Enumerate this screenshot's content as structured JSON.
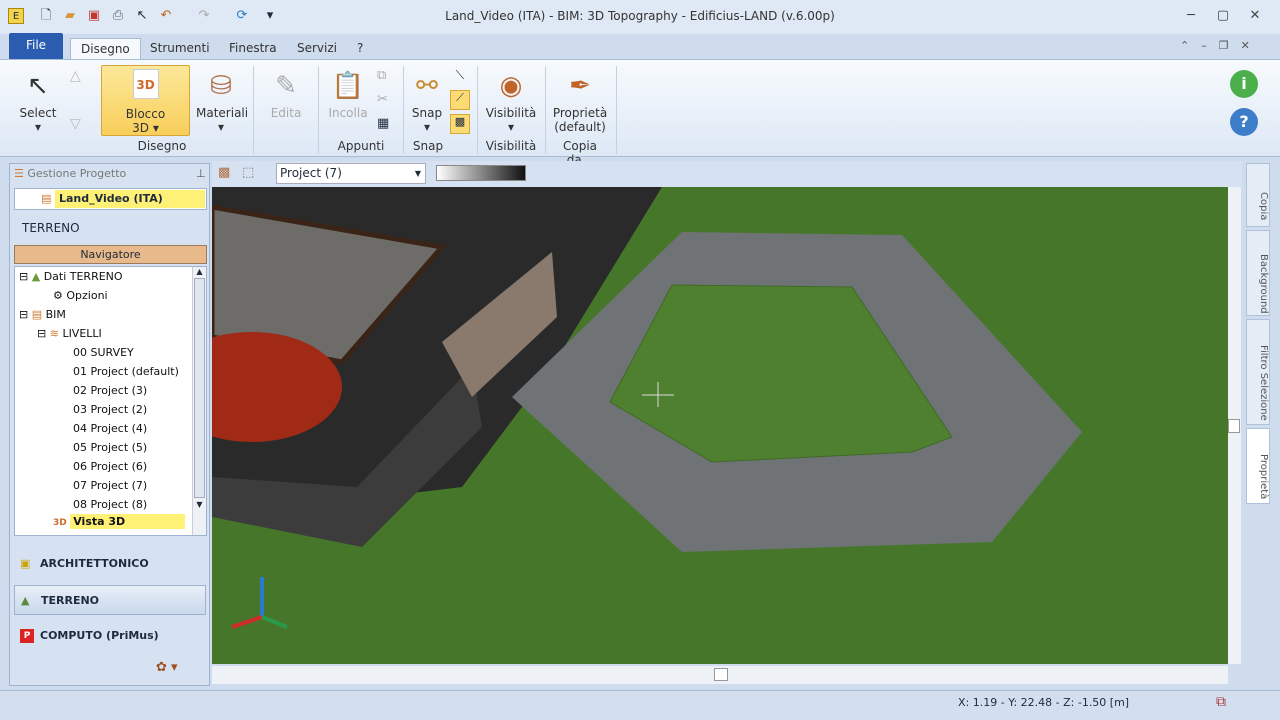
{
  "window": {
    "title": "Land_Video (ITA)  -  BIM: 3D Topography - Edificius-LAND (v.6.00p)"
  },
  "menu": {
    "file": "File",
    "tabs": [
      "Disegno",
      "Strumenti",
      "Finestra",
      "Servizi",
      "?"
    ],
    "active": "Disegno"
  },
  "ribbon": {
    "select": "Select",
    "blocco": "Blocco",
    "blocco2": "3D",
    "materiali": "Materiali",
    "edita": "Edita",
    "incolla": "Incolla",
    "snap": "Snap",
    "visibilita": "Visibilità",
    "proprieta": "Proprietà",
    "proprieta2": "(default)",
    "groups": {
      "disegno": "Disegno",
      "appunti": "Appunti",
      "snap": "Snap",
      "visibilita": "Visibilità",
      "copia": "Copia da..."
    }
  },
  "panel": {
    "title": "Gestione Progetto",
    "project": "Land_Video (ITA)",
    "section": "TERRENO",
    "navigator": "Navigatore",
    "tree": [
      "Dati TERRENO",
      "Opzioni",
      "BIM",
      "LIVELLI",
      "00 SURVEY",
      "01 Project (default)",
      "02 Project (3)",
      "03 Project (2)",
      "04 Project (4)",
      "05 Project (5)",
      "06 Project (6)",
      "07 Project (7)",
      "08 Project (8)",
      "Vista 3D"
    ],
    "modules": [
      "ARCHITETTONICO",
      "TERRENO",
      "COMPUTO (PriMus)"
    ]
  },
  "viewtoolbar": {
    "level": "Project (7)"
  },
  "righttabs": [
    "Copia",
    "Background",
    "Filtro Selezione",
    "Proprietà"
  ],
  "status": {
    "coords": "X: 1.19 - Y: 22.48 - Z: -1.50 [m]"
  },
  "colors": {
    "highlight": "#fff176",
    "accent": "#2a5db0",
    "navigator": "#e8b98a"
  }
}
